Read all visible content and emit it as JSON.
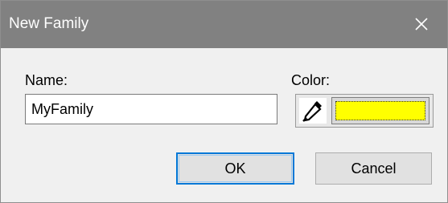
{
  "window": {
    "title": "New Family",
    "close_icon": "close-icon"
  },
  "form": {
    "name_label": "Name:",
    "name_value": "MyFamily",
    "color_label": "Color:",
    "color_value": "#ffff00",
    "dropper_icon": "eyedropper-icon"
  },
  "buttons": {
    "ok_label": "OK",
    "cancel_label": "Cancel"
  },
  "colors": {
    "titlebar": "#818181",
    "dialog_bg": "#f0f0f0",
    "ok_focus_border": "#0078d7",
    "swatch": "#ffff00"
  }
}
